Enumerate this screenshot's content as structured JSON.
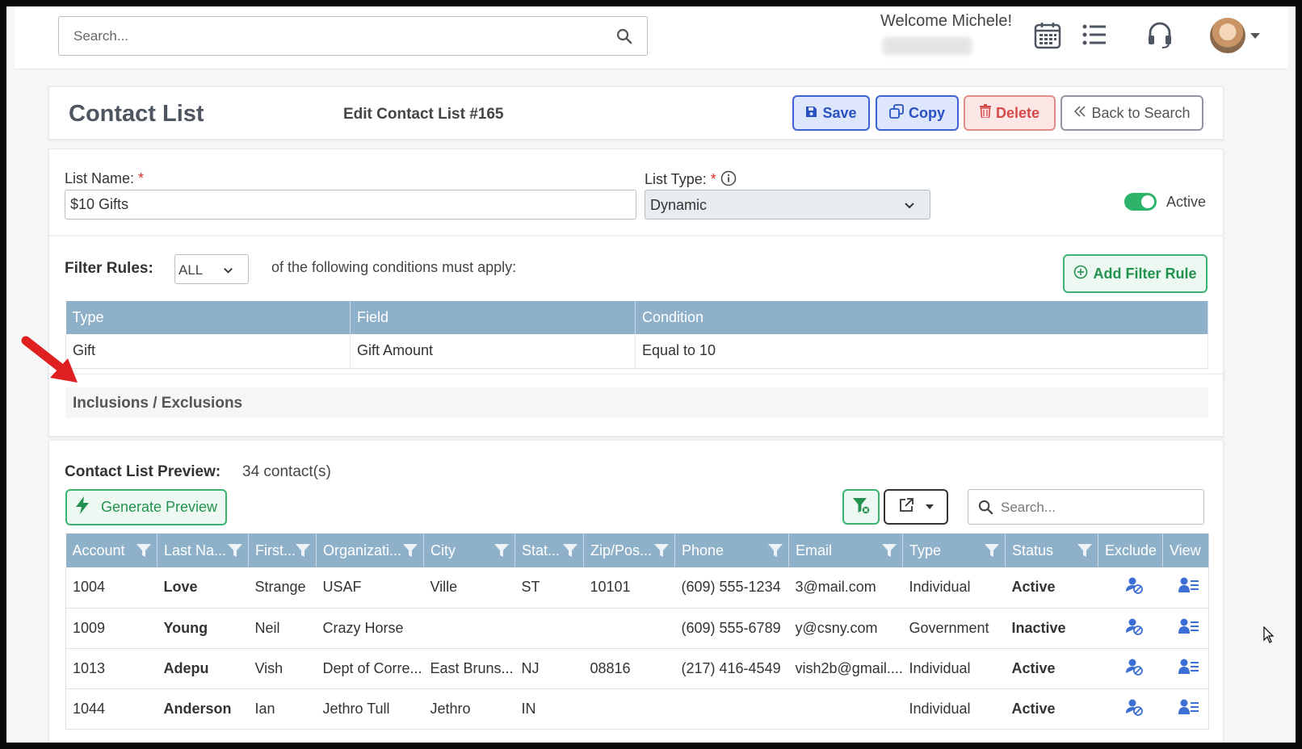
{
  "topbar": {
    "search_placeholder": "Search...",
    "welcome": "Welcome Michele!",
    "icons": [
      "calendar-icon",
      "list-icon",
      "headset-icon"
    ]
  },
  "header": {
    "title": "Contact List",
    "subtitle": "Edit Contact List #165",
    "save": "Save",
    "copy": "Copy",
    "delete": "Delete",
    "back": "Back to Search"
  },
  "form": {
    "list_name_label": "List Name:",
    "list_name_value": "$10 Gifts",
    "list_type_label": "List Type:",
    "list_type_value": "Dynamic",
    "required_mark": "*",
    "active_label": "Active",
    "active_on": true
  },
  "filters": {
    "label": "Filter Rules:",
    "match": "ALL",
    "text": "of the following conditions must apply:",
    "add_button": "Add Filter Rule",
    "columns": [
      "Type",
      "Field",
      "Condition"
    ],
    "rows": [
      [
        "Gift",
        "Gift Amount",
        "Equal to 10"
      ]
    ]
  },
  "inclusions": {
    "title": "Inclusions / Exclusions"
  },
  "preview": {
    "label": "Contact List Preview:",
    "count": "34 contact(s)",
    "generate_button": "Generate Preview",
    "search_placeholder": "Search...",
    "columns": [
      "Account",
      "Last Na...",
      "First...",
      "Organizati...",
      "City",
      "Stat...",
      "Zip/Pos...",
      "Phone",
      "Email",
      "Type",
      "Status",
      "Exclude",
      "View"
    ],
    "rows": [
      {
        "account": "1004",
        "last": "Love",
        "first": "Strange",
        "org": "USAF",
        "city": "Ville",
        "state": "ST",
        "zip": "10101",
        "phone": "(609) 555-1234",
        "email": "3@mail.com",
        "type": "Individual",
        "status": "Active"
      },
      {
        "account": "1009",
        "last": "Young",
        "first": "Neil",
        "org": "Crazy Horse",
        "city": "",
        "state": "",
        "zip": "",
        "phone": "(609) 555-6789",
        "email": "y@csny.com",
        "type": "Government",
        "status": "Inactive"
      },
      {
        "account": "1013",
        "last": "Adepu",
        "first": "Vish",
        "org": "Dept of Corre...",
        "city": "East Bruns...",
        "state": "NJ",
        "zip": "08816",
        "phone": "(217) 416-4549",
        "email": "vish2b@gmail....",
        "type": "Individual",
        "status": "Active"
      },
      {
        "account": "1044",
        "last": "Anderson",
        "first": "Ian",
        "org": "Jethro Tull",
        "city": "Jethro",
        "state": "IN",
        "zip": "",
        "phone": "",
        "email": "",
        "type": "Individual",
        "status": "Active"
      }
    ]
  },
  "colors": {
    "primary": "#3b63d6",
    "danger": "#d54b4b",
    "success": "#3cb371",
    "table_header": "#8fb0c9",
    "status_active": "#3cb83c",
    "status_inactive": "#9aa0a6",
    "annotation_arrow": "#e02020"
  }
}
